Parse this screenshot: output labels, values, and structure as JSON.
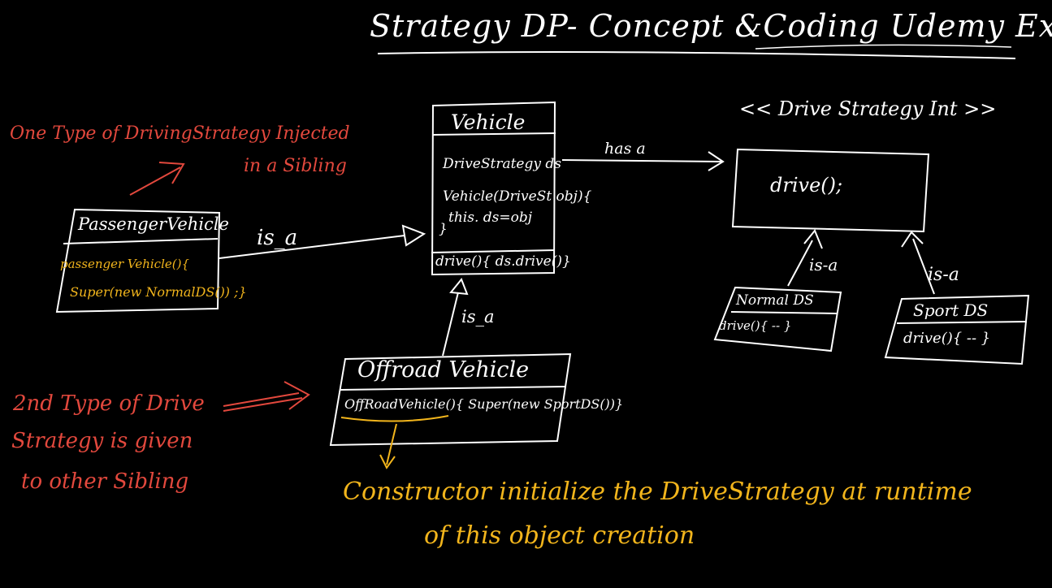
{
  "title": "Strategy DP- Concept &Coding Udemy Ex :",
  "vehicle": {
    "name": "Vehicle",
    "field": "DriveStrategy ds",
    "ctor_line1": "Vehicle(DriveSt obj){",
    "ctor_line2": "this. ds=obj",
    "ctor_close": "}",
    "method": "drive(){ ds.drive()}"
  },
  "has_a_label": "has a",
  "interface": {
    "stereotype": "<< Drive Strategy Int >>",
    "method": "drive();"
  },
  "passenger_vehicle": {
    "name": "PassengerVehicle",
    "ctor_line1": "passenger Vehicle(){",
    "ctor_line2": "Super(new NormalDS()) ;}"
  },
  "offroad_vehicle": {
    "name": "Offroad Vehicle",
    "ctor": "OffRoadVehicle(){ Super(new SportDS())}"
  },
  "normal_ds": {
    "name": "Normal DS",
    "method": "drive(){ -- }"
  },
  "sport_ds": {
    "name": "Sport DS",
    "method": "drive(){ -- }"
  },
  "is_a_labels": {
    "passenger": "is_a",
    "offroad": "is_a",
    "normal": "is-a",
    "sport": "is-a"
  },
  "notes": {
    "one_type_line1": "One Type of DrivingStrategy Injected",
    "one_type_line2": "in a Sibling",
    "second_type_line1": "2nd Type of Drive",
    "second_type_line2": "Strategy is given",
    "second_type_line3": "to other Sibling",
    "constructor_line1": "Constructor initialize the DriveStrategy at runtime",
    "constructor_line2": "of this object creation"
  },
  "colors": {
    "background": "#000000",
    "white_ink": "#ffffff",
    "red_ink": "#e2483d",
    "yellow_ink": "#f2b51c"
  }
}
